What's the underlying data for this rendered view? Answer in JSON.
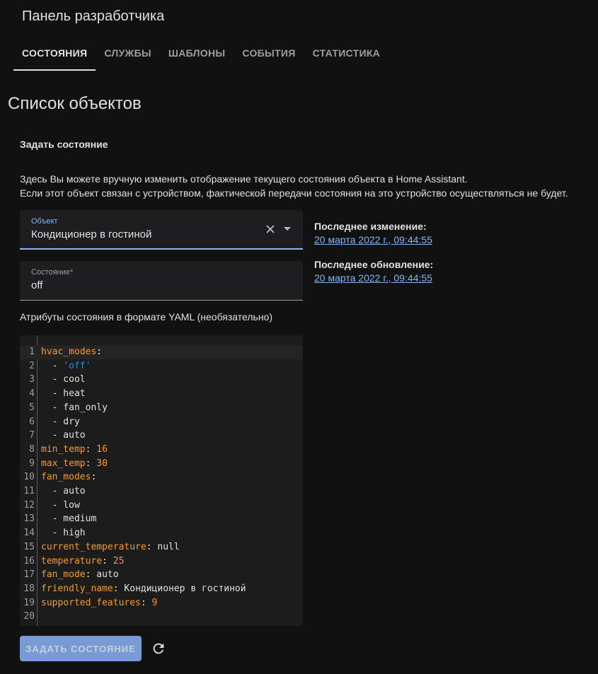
{
  "header": {
    "title": "Панель разработчика",
    "tabs": [
      {
        "label": "СОСТОЯНИЯ",
        "active": true
      },
      {
        "label": "СЛУЖБЫ",
        "active": false
      },
      {
        "label": "ШАБЛОНЫ",
        "active": false
      },
      {
        "label": "СОБЫТИЯ",
        "active": false
      },
      {
        "label": "СТАТИСТИКА",
        "active": false
      }
    ]
  },
  "main": {
    "section_title": "Список объектов",
    "set_state_title": "Задать состояние",
    "description_line1": "Здесь Вы можете вручную изменить отображение текущего состояния объекта в Home Assistant.",
    "description_line2": "Если этот объект связан с устройством, фактической передачи состояния на это устройство осуществляться не будет.",
    "entity_field": {
      "label": "Объект",
      "value": "Кондиционер в гостиной"
    },
    "state_field": {
      "label": "Состояние*",
      "value": "off"
    },
    "last_changed": {
      "label": "Последнее изменение:",
      "value": "20 марта 2022 г., 09:44:55"
    },
    "last_updated": {
      "label": "Последнее обновление:",
      "value": "20 марта 2022 г., 09:44:55"
    },
    "attributes_label": "Атрибуты состояния в формате YAML (необязательно)",
    "editor_lines": [
      [
        {
          "t": "hvac_modes",
          "c": "key"
        },
        {
          "t": ":",
          "c": ""
        }
      ],
      [
        {
          "t": "  - ",
          "c": ""
        },
        {
          "t": "'off'",
          "c": "str"
        }
      ],
      [
        {
          "t": "  - cool",
          "c": ""
        }
      ],
      [
        {
          "t": "  - heat",
          "c": ""
        }
      ],
      [
        {
          "t": "  - fan_only",
          "c": ""
        }
      ],
      [
        {
          "t": "  - dry",
          "c": ""
        }
      ],
      [
        {
          "t": "  - auto",
          "c": ""
        }
      ],
      [
        {
          "t": "min_temp",
          "c": "key"
        },
        {
          "t": ": ",
          "c": ""
        },
        {
          "t": "16",
          "c": "num"
        }
      ],
      [
        {
          "t": "max_temp",
          "c": "key"
        },
        {
          "t": ": ",
          "c": ""
        },
        {
          "t": "30",
          "c": "num"
        }
      ],
      [
        {
          "t": "fan_modes",
          "c": "key"
        },
        {
          "t": ":",
          "c": ""
        }
      ],
      [
        {
          "t": "  - auto",
          "c": ""
        }
      ],
      [
        {
          "t": "  - low",
          "c": ""
        }
      ],
      [
        {
          "t": "  - medium",
          "c": ""
        }
      ],
      [
        {
          "t": "  - high",
          "c": ""
        }
      ],
      [
        {
          "t": "current_temperature",
          "c": "key"
        },
        {
          "t": ": null",
          "c": ""
        }
      ],
      [
        {
          "t": "temperature",
          "c": "key"
        },
        {
          "t": ": ",
          "c": ""
        },
        {
          "t": "25",
          "c": "num"
        }
      ],
      [
        {
          "t": "fan_mode",
          "c": "key"
        },
        {
          "t": ": auto",
          "c": ""
        }
      ],
      [
        {
          "t": "friendly_name",
          "c": "key"
        },
        {
          "t": ": Кондиционер в гостиной",
          "c": ""
        }
      ],
      [
        {
          "t": "supported_features",
          "c": "key"
        },
        {
          "t": ": ",
          "c": ""
        },
        {
          "t": "9",
          "c": "num"
        }
      ],
      []
    ],
    "set_state_button": "ЗАДАТЬ СОСТОЯНИЕ",
    "icons": {
      "clear": "close-icon",
      "dropdown": "chevron-down-icon",
      "refresh": "refresh-icon"
    }
  }
}
